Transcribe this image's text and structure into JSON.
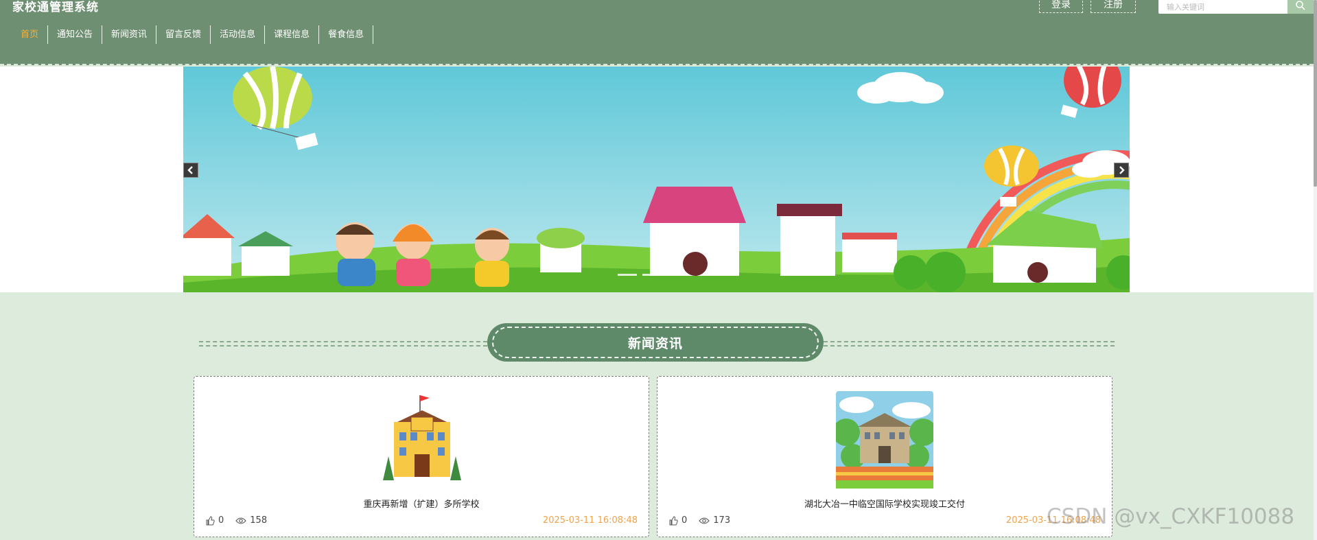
{
  "header": {
    "site_title": "家校通管理系统",
    "nav": [
      "首页",
      "通知公告",
      "新闻资讯",
      "留言反馈",
      "活动信息",
      "课程信息",
      "餐食信息"
    ],
    "login": "登录",
    "register": "注册",
    "search_placeholder": "输入关键词",
    "icons": {
      "search": "search-icon",
      "prev": "chevron-left-icon",
      "next": "chevron-right-icon"
    }
  },
  "section": {
    "title": "新闻资讯"
  },
  "news": [
    {
      "title": "重庆再新增（扩建）多所学校",
      "likes": "0",
      "views": "158",
      "date": "2025-03-11 16:08:48"
    },
    {
      "title": "湖北大冶一中临空国际学校实现竣工交付",
      "likes": "0",
      "views": "173",
      "date": "2025-03-11 16:08:48"
    }
  ],
  "watermark": "CSDN @vx_CXKF10088",
  "colors": {
    "header": "#6f8f72",
    "accent": "#f3b13c",
    "section_bg": "#ddebdd",
    "date": "#f0a34a"
  }
}
